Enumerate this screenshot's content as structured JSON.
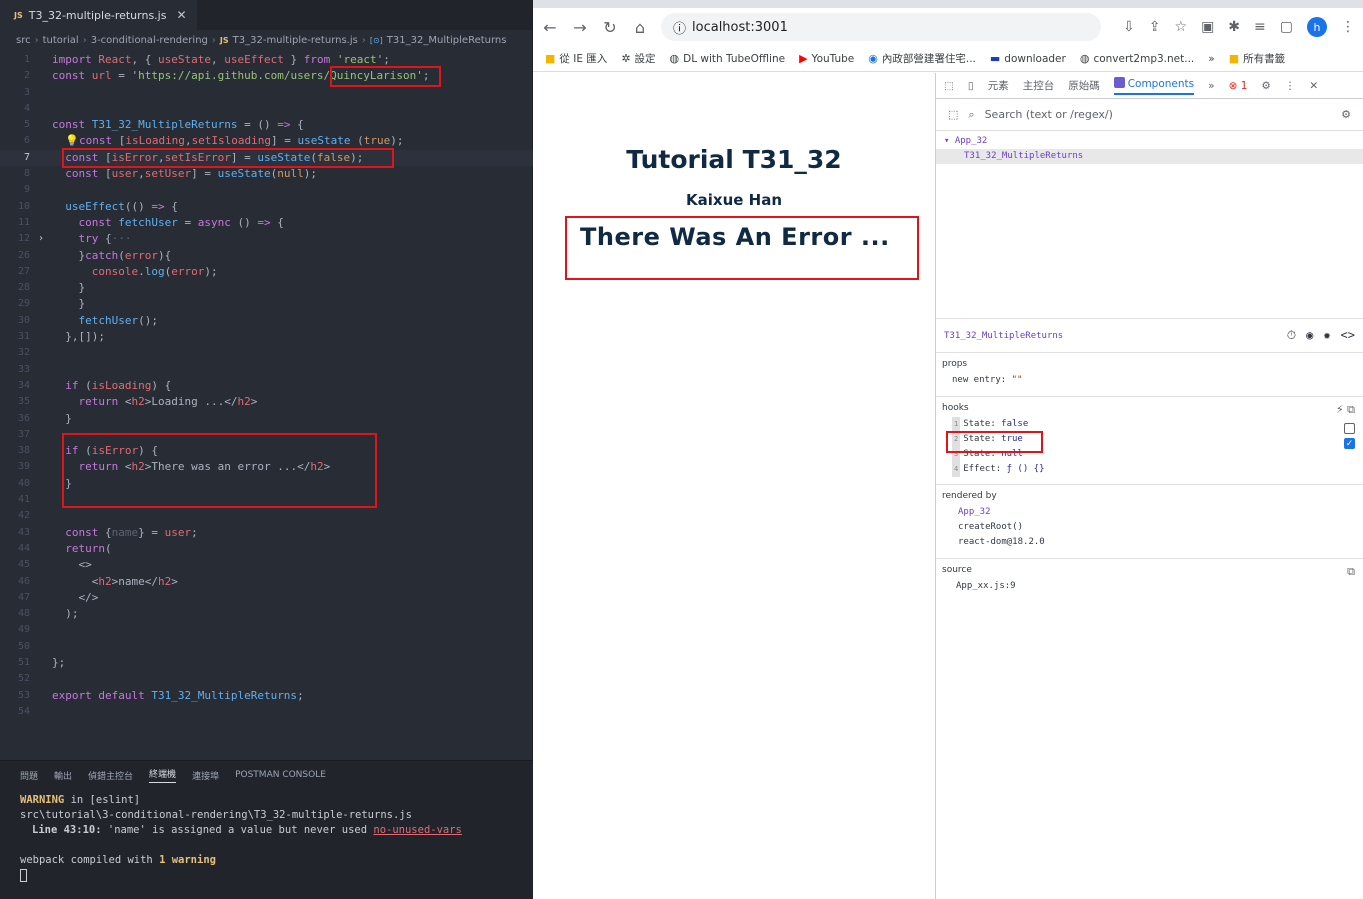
{
  "editor": {
    "tab": {
      "badge": "JS",
      "name": "T3_32-multiple-returns.js",
      "close": "✕"
    },
    "breadcrumb": [
      "src",
      "tutorial",
      "3-conditional-rendering",
      "T3_32-multiple-returns.js",
      "T31_32_MultipleReturns"
    ],
    "lines": [
      {
        "n": "1",
        "html": "<span class='k'>import</span> <span class='v'>React</span>, { <span class='v'>useState</span>, <span class='v'>useEffect</span> } <span class='k'>from</span> <span class='s'>'react'</span>;"
      },
      {
        "n": "2",
        "html": "<span class='k'>const</span> <span class='v'>url</span> = <span class='s'>'https://api.github.com/users/QuincyLarison'</span>;"
      },
      {
        "n": "3",
        "html": ""
      },
      {
        "n": "4",
        "html": ""
      },
      {
        "n": "5",
        "html": "<span class='k'>const</span> <span class='f'>T31_32_MultipleReturns</span> = () <span class='k'>=&gt;</span> {"
      },
      {
        "n": "6",
        "html": "  <span class='bulb'>💡</span><span class='k'>const</span> [<span class='v'>isLoading</span>,<span class='v'>setIsloading</span>] = <span class='f'>useState</span> (<span class='c'>true</span>);"
      },
      {
        "n": "7",
        "html": "  <span class='k'>const</span> [<span class='v'>isError</span>,<span class='v'>setIsError</span>] = <span class='f'>useState</span>(<span class='c'>false</span>);",
        "active": true
      },
      {
        "n": "8",
        "html": "  <span class='k'>const</span> [<span class='v'>user</span>,<span class='v'>setUser</span>] = <span class='f'>useState</span>(<span class='c'>null</span>);"
      },
      {
        "n": "9",
        "html": ""
      },
      {
        "n": "10",
        "html": "  <span class='f'>useEffect</span>(() <span class='k'>=&gt;</span> {"
      },
      {
        "n": "11",
        "html": "    <span class='k'>const</span> <span class='f'>fetchUser</span> = <span class='k'>async</span> () <span class='k'>=&gt;</span> {"
      },
      {
        "n": "12",
        "html": "    <span class='k'>try</span> {<span class='dim'>···</span>",
        "fold": "›"
      },
      {
        "n": "26",
        "html": "    }<span class='k'>catch</span>(<span class='v'>error</span>){"
      },
      {
        "n": "27",
        "html": "      <span class='v'>console</span>.<span class='f'>log</span>(<span class='v'>error</span>);"
      },
      {
        "n": "28",
        "html": "    }"
      },
      {
        "n": "29",
        "html": "    }"
      },
      {
        "n": "30",
        "html": "    <span class='f'>fetchUser</span>();"
      },
      {
        "n": "31",
        "html": "  },[]);"
      },
      {
        "n": "32",
        "html": ""
      },
      {
        "n": "33",
        "html": ""
      },
      {
        "n": "34",
        "html": "  <span class='k'>if</span> (<span class='v'>isLoading</span>) {"
      },
      {
        "n": "35",
        "html": "    <span class='k'>return</span> &lt;<span class='v'>h2</span>&gt;Loading ...&lt;/<span class='v'>h2</span>&gt;"
      },
      {
        "n": "36",
        "html": "  }"
      },
      {
        "n": "37",
        "html": ""
      },
      {
        "n": "38",
        "html": "  <span class='k'>if</span> (<span class='v'>isError</span>) {"
      },
      {
        "n": "39",
        "html": "    <span class='k'>return</span> &lt;<span class='v'>h2</span>&gt;There was an error ...&lt;/<span class='v'>h2</span>&gt;"
      },
      {
        "n": "40",
        "html": "  }"
      },
      {
        "n": "41",
        "html": ""
      },
      {
        "n": "42",
        "html": ""
      },
      {
        "n": "43",
        "html": "  <span class='k'>const</span> {<span class='dim'>name</span>} = <span class='v'>user</span>;"
      },
      {
        "n": "44",
        "html": "  <span class='k'>return</span>("
      },
      {
        "n": "45",
        "html": "    &lt;&gt;"
      },
      {
        "n": "46",
        "html": "      &lt;<span class='v'>h2</span>&gt;name&lt;/<span class='v'>h2</span>&gt;"
      },
      {
        "n": "47",
        "html": "    &lt;/&gt;"
      },
      {
        "n": "48",
        "html": "  );"
      },
      {
        "n": "49",
        "html": ""
      },
      {
        "n": "50",
        "html": ""
      },
      {
        "n": "51",
        "html": "};"
      },
      {
        "n": "52",
        "html": ""
      },
      {
        "n": "53",
        "html": "<span class='k'>export</span> <span class='k'>default</span> <span class='f'>T31_32_MultipleReturns</span>;"
      },
      {
        "n": "54",
        "html": ""
      }
    ],
    "panel_tabs": [
      "問題",
      "輸出",
      "偵錯主控台",
      "終端機",
      "連接埠",
      "POSTMAN CONSOLE"
    ],
    "panel_active": "終端機",
    "terminal": {
      "warning_word": "WARNING",
      "warning_rest": " in [eslint]",
      "path": "src\\tutorial\\3-conditional-rendering\\T3_32-multiple-returns.js",
      "line_ref": "Line 43:10:",
      "message": "  'name' is assigned a value but never used  ",
      "rule": "no-unused-vars",
      "compiled_prefix": "webpack compiled with ",
      "compiled_count": "1 warning"
    }
  },
  "browser": {
    "url": "localhost:3001",
    "bookmarks": [
      "從 IE 匯入",
      "設定",
      "DL with TubeOffline",
      "YouTube",
      "內政部營建署住宅...",
      "downloader",
      "convert2mp3.net...",
      "所有書籤"
    ],
    "more": "»",
    "avatar": "h",
    "page": {
      "title": "Tutorial T31_32",
      "author": "Kaixue Han",
      "message": "There Was An Error ..."
    },
    "devtools": {
      "tabs": [
        "元素",
        "主控台",
        "原始碼",
        "Components"
      ],
      "active_tab": "Components",
      "more": "»",
      "error_count": "1",
      "search_placeholder": "Search (text or /regex/)",
      "tree": [
        "▾ App_32",
        "T31_32_MultipleReturns"
      ],
      "selected": "T31_32_MultipleReturns",
      "props_title": "props",
      "props": [
        {
          "key": "new entry",
          "value": "\"\""
        }
      ],
      "hooks_title": "hooks",
      "hooks": [
        {
          "idx": "1",
          "key": "State",
          "value": "false",
          "checked": false
        },
        {
          "idx": "2",
          "key": "State",
          "value": "true",
          "checked": true
        },
        {
          "idx": "3",
          "key": "State",
          "value": "null"
        },
        {
          "idx": "4",
          "key": "Effect",
          "value": "ƒ () {}"
        }
      ],
      "rendered_by_title": "rendered by",
      "rendered_by": [
        "App_32",
        "createRoot()",
        "react-dom@18.2.0"
      ],
      "source_title": "source",
      "source": "App_xx.js:9"
    }
  },
  "colors": {
    "highlight_box": "#e0141b",
    "accent": "#1a73e8"
  }
}
